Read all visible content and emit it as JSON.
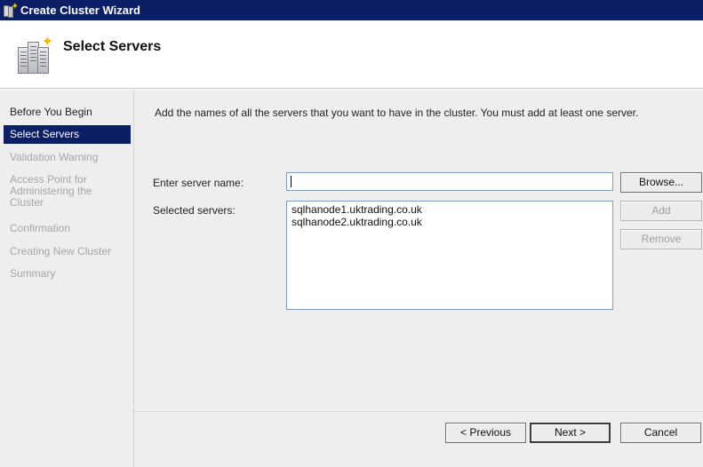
{
  "window": {
    "title": "Create Cluster Wizard"
  },
  "header": {
    "title": "Select Servers"
  },
  "steps": [
    {
      "label": "Before You Begin",
      "state": "done"
    },
    {
      "label": "Select Servers",
      "state": "active"
    },
    {
      "label": "Validation Warning",
      "state": "pending"
    },
    {
      "label": "Access Point for Administering the Cluster",
      "state": "pending"
    },
    {
      "label": "Confirmation",
      "state": "pending"
    },
    {
      "label": "Creating New Cluster",
      "state": "pending"
    },
    {
      "label": "Summary",
      "state": "pending"
    }
  ],
  "main": {
    "instructions": "Add the names of all the servers that you want to have in the cluster. You must add at least one server.",
    "server_name_label": "Enter server name:",
    "server_name_value": "",
    "selected_servers_label": "Selected servers:",
    "selected_servers": [
      "sqlhanode1.uktrading.co.uk",
      "sqlhanode2.uktrading.co.uk"
    ],
    "browse_label": "Browse...",
    "add_label": "Add",
    "remove_label": "Remove"
  },
  "footer": {
    "previous_label": "< Previous",
    "next_label": "Next >",
    "cancel_label": "Cancel"
  },
  "colors": {
    "titlebar": "#0c1f66",
    "selection": "#0c1f66",
    "panel": "#eeeeee"
  }
}
